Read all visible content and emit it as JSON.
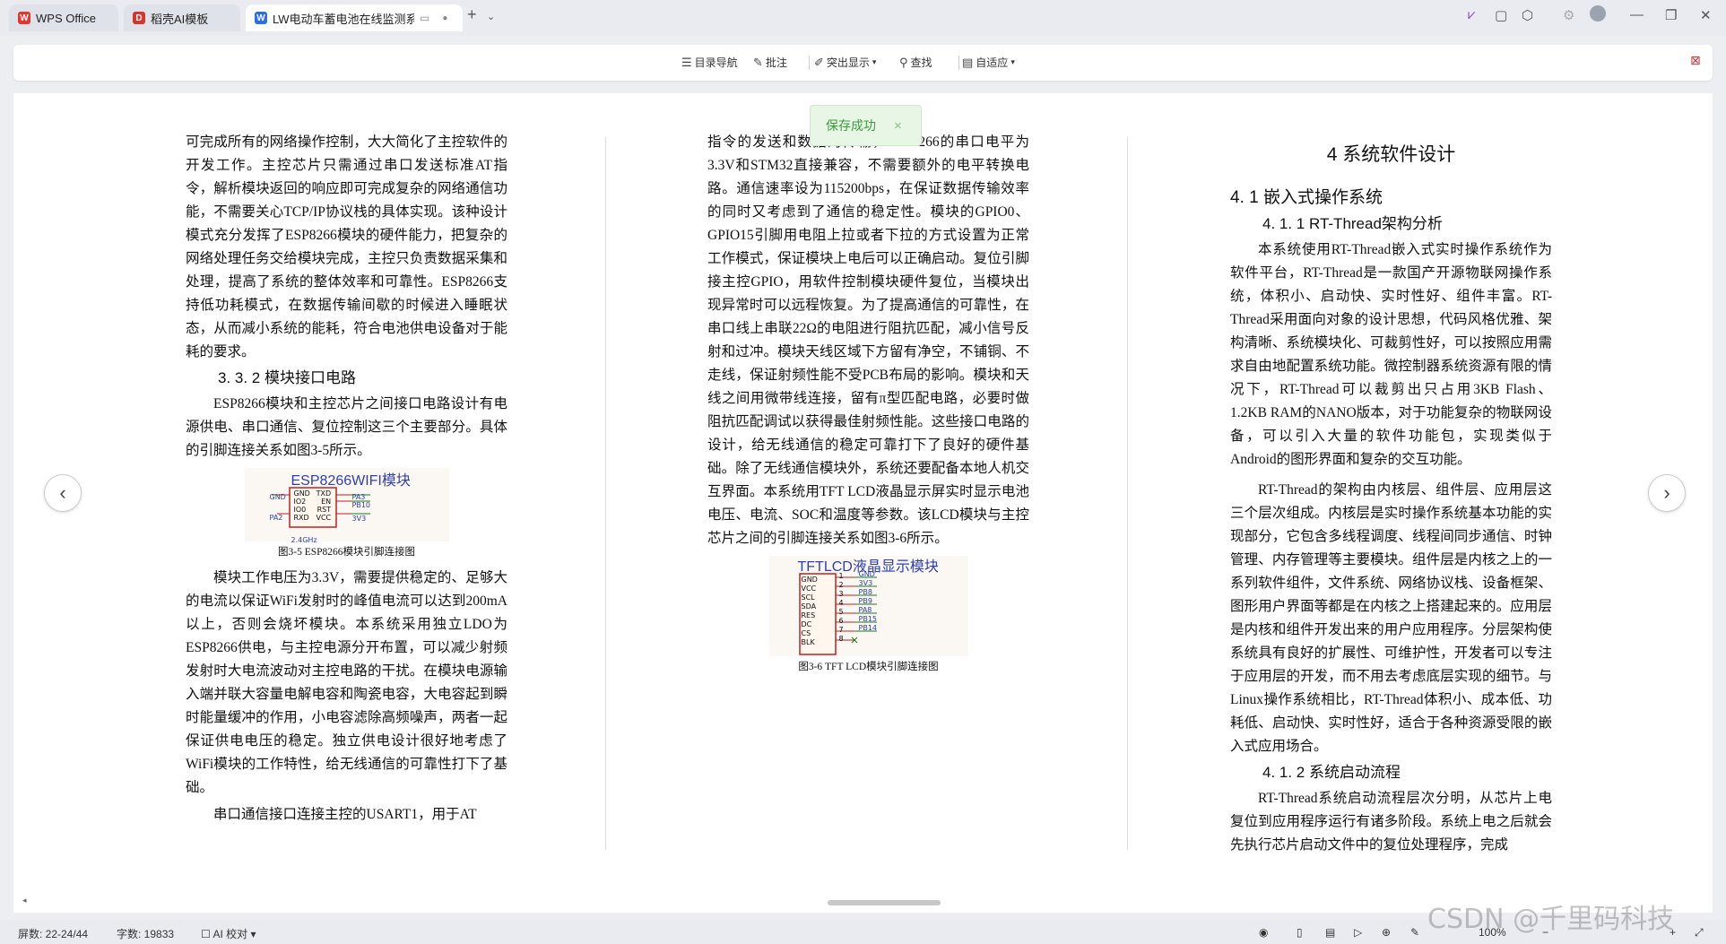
{
  "tabs": [
    {
      "label": "WPS Office",
      "icon": "wps-icon"
    },
    {
      "label": "稻壳AI模板",
      "icon": "docer-icon"
    },
    {
      "label": "LW电动车蓄电池在线监测系",
      "icon": "word-doc-icon"
    }
  ],
  "toolbar": {
    "toc_label": "目录导航",
    "comment_label": "批注",
    "highlight_label": "突出显示",
    "find_label": "查找",
    "fit_label": "自适应"
  },
  "toast": {
    "text": "保存成功",
    "close": "×"
  },
  "left_col": {
    "p1": "可完成所有的网络操作控制，大大简化了主控软件的开发工作。主控芯片只需通过串口发送标准AT指令，解析模块返回的响应即可完成复杂的网络通信功能，不需要关心TCP/IP协议栈的具体实现。该种设计模式充分发挥了ESP8266模块的硬件能力，把复杂的网络处理任务交给模块完成，主控只负责数据采集和处理，提高了系统的整体效率和可靠性。ESP8266支持低功耗模式，在数据传输间歇的时候进入睡眠状态，从而减小系统的能耗，符合电池供电设备对于能耗的要求。",
    "h_332": "3. 3. 2  模块接口电路",
    "p2": "ESP8266模块和主控芯片之间接口电路设计有电源供电、串口通信、复位控制这三个主要部分。具体的引脚连接关系如图3-5所示。",
    "fig_title": "ESP8266WIFI模块",
    "fig_pins_left": [
      "GND",
      "IO2",
      "IO0",
      "RXD"
    ],
    "fig_pins_right": [
      "TXD",
      "EN",
      "RST",
      "VCC"
    ],
    "fig_nets": [
      "GND",
      "PA3",
      "PB10",
      "PA2",
      "3V3",
      "2.4GHz"
    ],
    "caption": "图3-5  ESP8266模块引脚连接图",
    "p3": "模块工作电压为3.3V，需要提供稳定的、足够大的电流以保证WiFi发射时的峰值电流可以达到200mA以上，否则会烧坏模块。本系统采用独立LDO为ESP8266供电，与主控电源分开布置，可以减少射频发射时大电流波动对主控电路的干扰。在模块电源输入端并联大容量电解电容和陶瓷电容，大电容起到瞬时能量缓冲的作用，小电容滤除高频噪声，两者一起保证供电电压的稳定。独立供电设计很好地考虑了WiFi模块的工作特性，给无线通信的可靠性打下了基础。",
    "p4": "串口通信接口连接主控的USART1，用于AT"
  },
  "mid_col": {
    "p1": "指令的发送和数据的传输，ESP8266的串口电平为3.3V和STM32直接兼容，不需要额外的电平转换电路。通信速率设为115200bps，在保证数据传输效率的同时又考虑到了通信的稳定性。模块的GPIO0、GPIO15引脚用电阻上拉或者下拉的方式设置为正常工作模式，保证模块上电后可以正确启动。复位引脚接主控GPIO，用软件控制模块硬件复位，当模块出现异常时可以远程恢复。为了提高通信的可靠性，在串口线上串联22Ω的电阻进行阻抗匹配，减小信号反射和过冲。模块天线区域下方留有净空，不铺铜、不走线，保证射频性能不受PCB布局的影响。模块和天线之间用微带线连接，留有π型匹配电路，必要时做阻抗匹配调试以获得最佳射频性能。这些接口电路的设计，给无线通信的稳定可靠打下了良好的硬件基础。除了无线通信模块外，系统还要配备本地人机交互界面。本系统用TFT LCD液晶显示屏实时显示电池电压、电流、SOC和温度等参数。该LCD模块与主控芯片之间的引脚连接关系如图3-6所示。",
    "fig_title": "TFTLCD液晶显示模块",
    "fig_pins": [
      "GND",
      "VCC",
      "SCL",
      "SDA",
      "RES",
      "DC",
      "CS",
      "BLK"
    ],
    "fig_nums": [
      "1",
      "2",
      "3",
      "4",
      "5",
      "6",
      "7",
      "8"
    ],
    "fig_nets": [
      "GND",
      "3V3",
      "PB8",
      "PB9",
      "PA8",
      "PB15",
      "PB14"
    ],
    "caption": "图3-6  TFT LCD模块引脚连接图"
  },
  "right_col": {
    "h1": "4  系统软件设计",
    "h2": "4. 1  嵌入式操作系统",
    "h3a": "4. 1. 1  RT-Thread架构分析",
    "p1": "本系统使用RT-Thread嵌入式实时操作系统作为软件平台，RT-Thread是一款国产开源物联网操作系统，体积小、启动快、实时性好、组件丰富。RT-Thread采用面向对象的设计思想，代码风格优雅、架构清晰、系统模块化、可裁剪性好，可以按照应用需求自由地配置系统功能。微控制器系统资源有限的情况下，RT-Thread可以裁剪出只占用3KB Flash、1.2KB RAM的NANO版本，对于功能复杂的物联网设备，可以引入大量的软件功能包，实现类似于Android的图形界面和复杂的交互功能。",
    "p2": "RT-Thread的架构由内核层、组件层、应用层这三个层次组成。内核层是实时操作系统基本功能的实现部分，它包含多线程调度、线程间同步通信、时钟管理、内存管理等主要模块。组件层是内核之上的一系列软件组件，文件系统、网络协议栈、设备框架、图形用户界面等都是在内核之上搭建起来的。应用层是内核和组件开发出来的用户应用程序。分层架构使系统具有良好的扩展性、可维护性，开发者可以专注于应用层的开发，而不用去考虑底层实现的细节。与Linux操作系统相比，RT-Thread体积小、成本低、功耗低、启动快、实时性好，适合于各种资源受限的嵌入式应用场合。",
    "h3b": "4. 1. 2  系统启动流程",
    "p3": "RT-Thread系统启动流程层次分明，从芯片上电复位到应用程序运行有诸多阶段。系统上电之后就会先执行芯片启动文件中的复位处理程序，完成"
  },
  "statusbar": {
    "page": "屏数: 22-24/44",
    "words": "字数: 19833",
    "proof": "AI 校对",
    "zoom": "100%"
  },
  "watermark": "CSDN @千里码科技",
  "colors": {
    "accent": "#2e3fb5",
    "toast_green": "#3a9d3a",
    "wps_red": "#e8342f",
    "word_blue": "#2a6ee8"
  }
}
